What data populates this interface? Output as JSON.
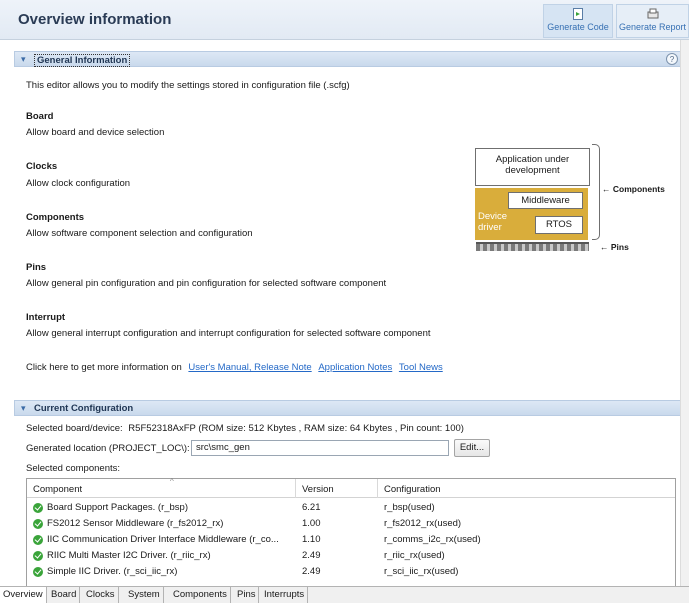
{
  "header": {
    "title": "Overview information",
    "generate_code": "Generate Code",
    "generate_report": "Generate Report"
  },
  "general": {
    "section_title": "General Information",
    "help": "?",
    "intro": "This editor allows you to modify the settings stored in configuration file (.scfg)",
    "items": [
      {
        "title": "Board",
        "desc": "Allow board and device selection"
      },
      {
        "title": "Clocks",
        "desc": "Allow clock configuration"
      },
      {
        "title": "Components",
        "desc": "Allow software component selection and configuration"
      },
      {
        "title": "Pins",
        "desc": "Allow general pin configuration and pin configuration for selected software component"
      },
      {
        "title": "Interrupt",
        "desc": "Allow general interrupt configuration and interrupt configuration for selected software component"
      }
    ],
    "more_info_prefix": "Click here to get more information on",
    "links": [
      "User's Manual, Release Note",
      "Application Notes",
      "Tool News"
    ]
  },
  "diagram": {
    "app_line1": "Application under",
    "app_line2": "development",
    "middleware": "Middleware",
    "device_line1": "Device",
    "device_line2": "driver",
    "rtos": "RTOS",
    "components_label": "Components",
    "pins_label": "Pins"
  },
  "current": {
    "section_title": "Current Configuration",
    "device_label": "Selected board/device:",
    "device_value": "R5F52318AxFP (ROM size: 512 Kbytes , RAM size: 64 Kbytes , Pin count: 100)",
    "location_label": "Generated location (PROJECT_LOC\\):",
    "location_value": "src\\smc_gen",
    "edit_label": "Edit...",
    "selected_label": "Selected components:",
    "columns": [
      "Component",
      "Version",
      "Configuration"
    ],
    "rows": [
      {
        "component": "Board Support Packages. (r_bsp)",
        "version": "6.21",
        "config": "r_bsp(used)"
      },
      {
        "component": "FS2012 Sensor Middleware (r_fs2012_rx)",
        "version": "1.00",
        "config": "r_fs2012_rx(used)"
      },
      {
        "component": "IIC Communication Driver Interface Middleware (r_co...",
        "version": "1.10",
        "config": "r_comms_i2c_rx(used)"
      },
      {
        "component": "RIIC Multi Master I2C Driver. (r_riic_rx)",
        "version": "2.49",
        "config": "r_riic_rx(used)"
      },
      {
        "component": "Simple IIC Driver. (r_sci_iic_rx)",
        "version": "2.49",
        "config": "r_sci_iic_rx(used)"
      }
    ]
  },
  "tabs": [
    "Overview",
    "Board",
    "Clocks",
    "System",
    "Components",
    "Pins",
    "Interrupts"
  ],
  "colors": {
    "accent": "#2469c7",
    "driver_yellow": "#d9ad3b",
    "check_green": "#3aa43a"
  }
}
